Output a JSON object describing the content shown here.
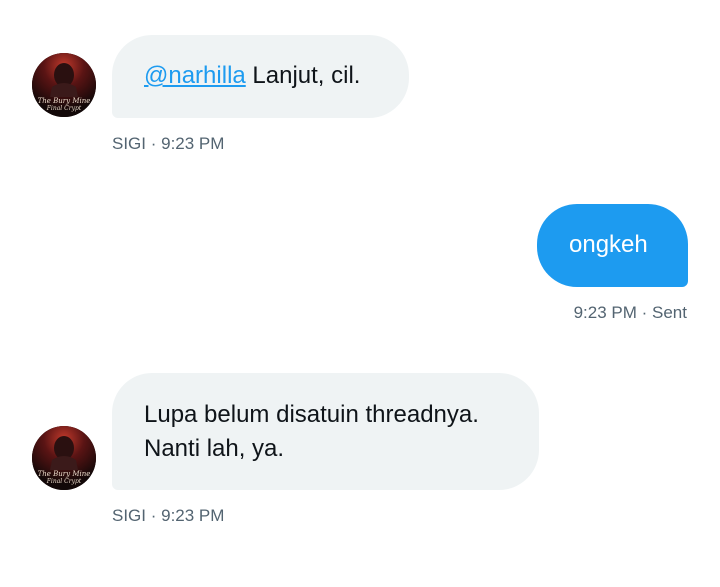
{
  "messages": [
    {
      "direction": "incoming",
      "mention": "@narhilla",
      "text": " Lanjut, cil.",
      "sender": "SIGI",
      "time": "9:23 PM",
      "avatar_caption": "The Bury Mine Final Crypt"
    },
    {
      "direction": "outgoing",
      "text": "ongkeh",
      "time": "9:23 PM",
      "status": "Sent"
    },
    {
      "direction": "incoming",
      "line1": "Lupa belum disatuin threadnya.",
      "line2": "Nanti lah, ya.",
      "sender": "SIGI",
      "time": "9:23 PM",
      "avatar_caption": "The Bury Mine Final Crypt"
    }
  ],
  "separator": " · ",
  "colors": {
    "incoming_bubble": "#eff3f4",
    "outgoing_bubble": "#1d9bf0",
    "mention": "#1d9bf0",
    "meta_text": "#536471"
  },
  "icons": [
    "user-avatar-icon"
  ]
}
